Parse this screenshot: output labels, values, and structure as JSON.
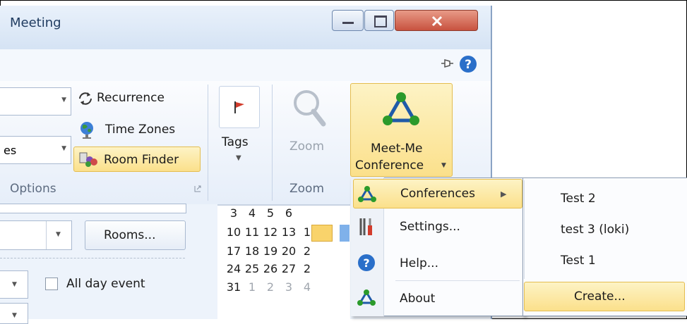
{
  "window": {
    "title": "Meeting"
  },
  "ribbon": {
    "options": {
      "combo1_value": "",
      "combo2_value": "es",
      "recurrence_label": "Recurrence",
      "time_zones_label": "Time Zones",
      "room_finder_label": "Room Finder",
      "group_label": "Options"
    },
    "tags": {
      "label": "Tags"
    },
    "zoom": {
      "button_label": "Zoom",
      "group_label": "Zoom"
    },
    "meetme": {
      "label_line1": "Meet-Me",
      "label_line2": "Conference"
    }
  },
  "body": {
    "rooms_button": "Rooms...",
    "all_day_event_label": "All day event"
  },
  "calendar": {
    "rows": [
      [
        "3",
        "4",
        "5",
        "6",
        ""
      ],
      [
        "10",
        "11",
        "12",
        "13",
        "1"
      ],
      [
        "17",
        "18",
        "19",
        "20",
        "2"
      ],
      [
        "24",
        "25",
        "26",
        "27",
        "2"
      ],
      [
        "31",
        "1",
        "2",
        "3",
        "4"
      ]
    ],
    "selected_day": "13"
  },
  "menu": {
    "items": [
      {
        "label": "Conferences"
      },
      {
        "label": "Settings..."
      },
      {
        "label": "Help..."
      },
      {
        "label": "About"
      }
    ]
  },
  "submenu": {
    "items": [
      {
        "label": "Test 2"
      },
      {
        "label": "test 3 (loki)"
      },
      {
        "label": "Test 1"
      },
      {
        "label": "Create..."
      }
    ]
  },
  "colors": {
    "accent": "#f9d36b",
    "title_text": "#1e3a5f",
    "close_button": "#c8523f",
    "help_blue": "#2a6fc9"
  }
}
